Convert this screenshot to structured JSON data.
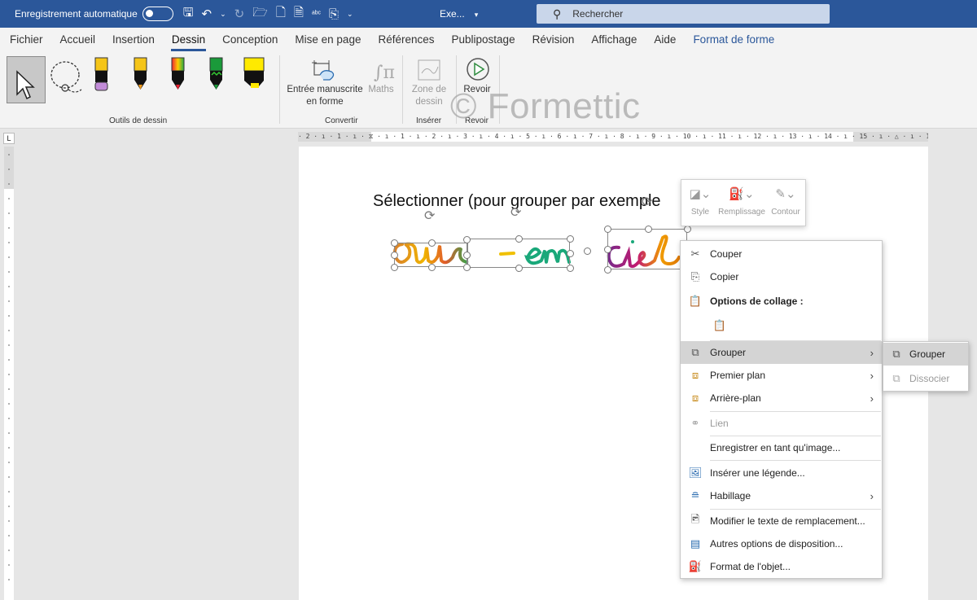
{
  "titlebar": {
    "autosave_label": "Enregistrement automatique",
    "doc_name": "Exe...",
    "search_placeholder": "Rechercher"
  },
  "tabs": [
    "Fichier",
    "Accueil",
    "Insertion",
    "Dessin",
    "Conception",
    "Mise en page",
    "Références",
    "Publipostage",
    "Révision",
    "Affichage",
    "Aide",
    "Format de forme"
  ],
  "active_tab": "Dessin",
  "ribbon": {
    "groups": {
      "drawing_tools": "Outils de dessin",
      "convert": "Convertir",
      "insert": "Insérer",
      "review": "Revoir"
    },
    "buttons": {
      "ink_to_shape_line1": "Entrée manuscrite",
      "ink_to_shape_line2": "en forme",
      "math": "Maths",
      "drawing_canvas_line1": "Zone de",
      "drawing_canvas_line2": "dessin",
      "replay": "Revoir"
    }
  },
  "watermark": "© Formettic",
  "document": {
    "text": "Sélectionner (pour grouper par exemple"
  },
  "mini_toolbar": {
    "style": "Style",
    "fill": "Remplissage",
    "outline": "Contour"
  },
  "context_menu": {
    "cut": "Couper",
    "copy": "Copier",
    "paste_options": "Options de collage :",
    "group": "Grouper",
    "bring_forward": "Premier plan",
    "send_backward": "Arrière-plan",
    "link": "Lien",
    "save_as_image": "Enregistrer en tant qu'image...",
    "insert_caption": "Insérer une légende...",
    "wrap_text": "Habillage",
    "edit_alt_text": "Modifier le texte de remplacement...",
    "more_layout": "Autres options de disposition...",
    "format_object": "Format de l'objet..."
  },
  "submenu": {
    "group": "Grouper",
    "ungroup": "Dissocier"
  },
  "ruler": {
    "h_ticks": "· 2 · ı · 1 · ı · ⧖ · ı · 1 · ı · 2 · ı · 3 · ı · 4 · ı · 5 · ı · 6 · ı · 7 · ı · 8 · ı · 9 · ı · 10 · ı · 11 · ı · 12 · ı · 13 · ı · 14 · ı · 15 · ı · △ · ı · 17 · ı · 18 ·",
    "corner": "L"
  },
  "colors": {
    "accent": "#2b579a",
    "highlight": "#d4d4d4"
  }
}
